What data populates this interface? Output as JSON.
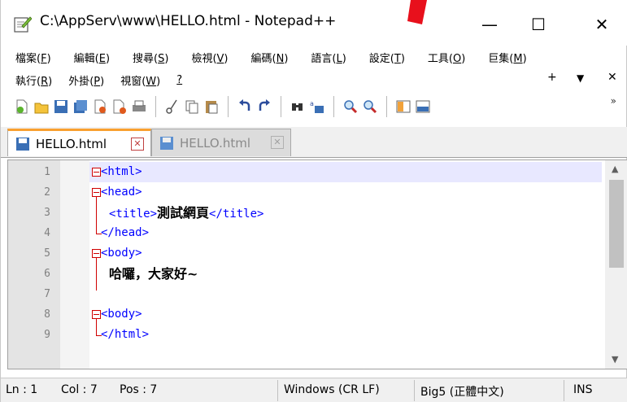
{
  "window": {
    "title": "C:\\AppServ\\www\\HELLO.html - Notepad++",
    "minimize": "—",
    "maximize": "☐",
    "close": "✕"
  },
  "menu": {
    "row1": [
      {
        "label": "檔案(",
        "key": "F",
        "end": ")"
      },
      {
        "label": "編輯(",
        "key": "E",
        "end": ")"
      },
      {
        "label": "搜尋(",
        "key": "S",
        "end": ")"
      },
      {
        "label": "檢視(",
        "key": "V",
        "end": ")"
      },
      {
        "label": "編碼(",
        "key": "N",
        "end": ")"
      },
      {
        "label": "語言(",
        "key": "L",
        "end": ")"
      },
      {
        "label": "設定(",
        "key": "T",
        "end": ")"
      },
      {
        "label": "工具(",
        "key": "O",
        "end": ")"
      },
      {
        "label": "巨集(",
        "key": "M",
        "end": ")"
      }
    ],
    "row2": [
      {
        "label": "執行(",
        "key": "R",
        "end": ")"
      },
      {
        "label": "外掛(",
        "key": "P",
        "end": ")"
      },
      {
        "label": "視窗(",
        "key": "W",
        "end": ")"
      },
      {
        "label": "",
        "key": "?",
        "end": ""
      }
    ],
    "right_plus": "+",
    "right_down": "▼",
    "right_close": "✕"
  },
  "toolbar": {
    "icons": [
      "new-file-icon",
      "open-file-icon",
      "save-icon",
      "save-all-icon",
      "close-file-icon",
      "close-all-icon",
      "print-icon",
      "cut-icon",
      "copy-icon",
      "paste-icon",
      "undo-icon",
      "redo-icon",
      "find-icon",
      "replace-icon",
      "zoom-in-icon",
      "zoom-out-icon",
      "sync-v-icon",
      "sync-h-icon"
    ],
    "more": "»"
  },
  "tabs": [
    {
      "label": "HELLO.html",
      "active": true
    },
    {
      "label": "HELLO.html",
      "active": false
    }
  ],
  "editor": {
    "lines": [
      {
        "num": "1",
        "tag": "<html>",
        "text": ""
      },
      {
        "num": "2",
        "tag": "<head>",
        "text": ""
      },
      {
        "num": "3",
        "tag": "<title>",
        "text": "測試網頁",
        "tag2": "</title>"
      },
      {
        "num": "4",
        "tag": "</head>",
        "text": ""
      },
      {
        "num": "5",
        "tag": "<body>",
        "text": ""
      },
      {
        "num": "6",
        "tag": "",
        "text": "哈囉，大家好~"
      },
      {
        "num": "7",
        "tag": "",
        "text": ""
      },
      {
        "num": "8",
        "tag": "<body>",
        "text": ""
      },
      {
        "num": "9",
        "tag": "</html>",
        "text": ""
      }
    ],
    "scroll_up": "▲",
    "scroll_down": "▼"
  },
  "status": {
    "ln": "Ln : 1",
    "col": "Col : 7",
    "pos": "Pos : 7",
    "eol": "Windows (CR LF)",
    "encoding": "Big5 (正體中文)",
    "mode": "INS"
  },
  "colors": {
    "tag": "#0000ff",
    "fold": "#d00000",
    "tab_accent": "#f9a030",
    "current_line": "#e8e8ff"
  }
}
